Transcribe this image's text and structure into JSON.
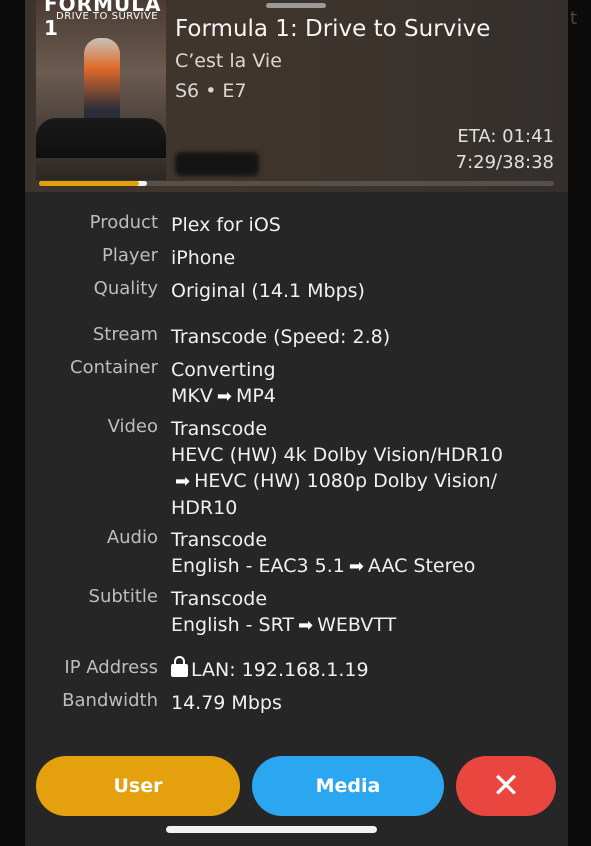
{
  "background_hint": "t",
  "header": {
    "poster_title": "FORMULA 1",
    "poster_subtitle": "DRIVE TO SURVIVE",
    "title": "Formula 1: Drive to Survive",
    "episode_title": "C’est la Vie",
    "episode_number": "S6 • E7",
    "eta": "ETA: 01:41",
    "progress_text": "7:29/38:38",
    "progress_fraction": 0.194,
    "buffer_fraction": 0.21
  },
  "details": {
    "product": {
      "label": "Product",
      "value": "Plex for iOS"
    },
    "player": {
      "label": "Player",
      "value": "iPhone"
    },
    "quality": {
      "label": "Quality",
      "value": "Original (14.1 Mbps)"
    },
    "stream": {
      "label": "Stream",
      "value": "Transcode (Speed: 2.8)"
    },
    "container": {
      "label": "Container",
      "line1": "Converting",
      "from": "MKV",
      "to": "MP4"
    },
    "video": {
      "label": "Video",
      "line1": "Transcode",
      "from": "HEVC (HW) 4k Dolby Vision/HDR10",
      "to": "HEVC (HW) 1080p Dolby Vision/",
      "to_cont": "HDR10"
    },
    "audio": {
      "label": "Audio",
      "line1": "Transcode",
      "from": "English - EAC3 5.1",
      "to": "AAC Stereo"
    },
    "subtitle": {
      "label": "Subtitle",
      "line1": "Transcode",
      "from": "English - SRT",
      "to": "WEBVTT"
    },
    "ip": {
      "label": "IP Address",
      "value": "LAN: 192.168.1.19"
    },
    "bandwidth": {
      "label": "Bandwidth",
      "value": "14.79 Mbps"
    }
  },
  "buttons": {
    "user": "User",
    "media": "Media",
    "close": "✕"
  },
  "icons": {
    "arrow": "➡",
    "lock": "lock-icon"
  },
  "colors": {
    "accent": "#e5a00d",
    "media": "#2aa7f0",
    "close": "#e8463f"
  }
}
